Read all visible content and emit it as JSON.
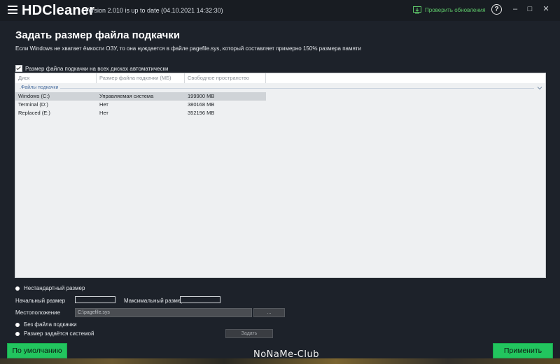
{
  "app": {
    "name": "HDCleaner",
    "version": "Version 2.010 is up to date (04.10.2021 14:32:30)",
    "check_updates": "Проверить обновления",
    "help": "?",
    "minimize": "–",
    "maximize": "□",
    "close": "✕"
  },
  "page": {
    "title": "Задать размер файла подкачки",
    "subtitle": "Если Windows не хватает ёмкости ОЗУ, то она нуждается в файле pagefile.sys, который составляет примерно 150% размера памяти"
  },
  "auto_checkbox": {
    "label": "Размер файла подкачки на всех дисках автоматически",
    "checked": true
  },
  "table": {
    "columns": [
      "Диск",
      "Размер файла подкачки (МБ)",
      "Свободное пространство"
    ],
    "group_label": "Файлы подкачки",
    "rows": [
      {
        "disk": "Windows (C:)",
        "size": "Управляемая система",
        "free": "199900 MB",
        "selected": true
      },
      {
        "disk": "Terminal (D:)",
        "size": "Нет",
        "free": "380168 MB",
        "selected": false
      },
      {
        "disk": "Replaced (E:)",
        "size": "Нет",
        "free": "352196 MB",
        "selected": false
      }
    ]
  },
  "form": {
    "custom_size": "Нестандартный размер",
    "initial_size": "Начальный размер",
    "max_size": "Максимальный размер",
    "location": "Местоположение",
    "location_value": "C:\\pagefile.sys",
    "browse": "...",
    "no_pagefile": "Без файла подкачки",
    "system_managed": "Размер задаётся системой",
    "set_button": "Задать"
  },
  "footer": {
    "default_button": "По умолчанию",
    "apply_button": "Применить",
    "watermark": "NoNaMe-Club"
  },
  "colors": {
    "accent_green": "#22c55e",
    "update_green": "#5ec96a",
    "window_bg": "#1d222a"
  }
}
